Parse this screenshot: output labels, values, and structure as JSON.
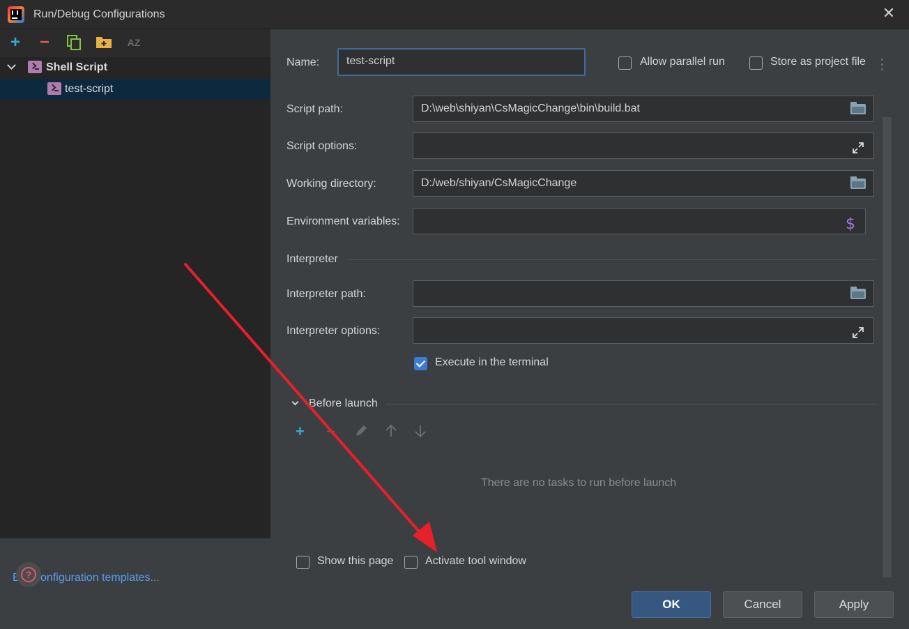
{
  "window": {
    "title": "Run/Debug Configurations"
  },
  "sidebar": {
    "toolbar": {
      "add": "+",
      "remove": "−",
      "copy": "copy-icon",
      "folder": "new-folder-icon",
      "sort": "AZ"
    },
    "tree": [
      {
        "label": "Shell Script",
        "expanded": true
      },
      {
        "label": "test-script",
        "selected": true
      }
    ],
    "edit_templates_link": "Edit configuration templates..."
  },
  "form": {
    "name_label": "Name:",
    "name_value": "test-script",
    "allow_parallel": {
      "label": "Allow parallel run",
      "checked": false
    },
    "store_project": {
      "label": "Store as project file",
      "checked": false
    },
    "script_path_label": "Script path:",
    "script_path_value": "D:\\web\\shiyan\\CsMagicChange\\bin\\build.bat",
    "script_options_label": "Script options:",
    "script_options_value": "",
    "working_dir_label": "Working directory:",
    "working_dir_value": "D:/web/shiyan/CsMagicChange",
    "env_vars_label": "Environment variables:",
    "env_vars_value": "",
    "interpreter_section": "Interpreter",
    "interpreter_path_label": "Interpreter path:",
    "interpreter_path_value": "",
    "interpreter_options_label": "Interpreter options:",
    "interpreter_options_value": "",
    "execute_terminal": {
      "label": "Execute in the terminal",
      "checked": true
    },
    "before_launch_section": "Before launch",
    "before_launch_empty": "There are no tasks to run before launch",
    "show_page": {
      "label": "Show this page",
      "checked": false
    },
    "activate_tool": {
      "label": "Activate tool window",
      "checked": false
    }
  },
  "buttons": {
    "ok": "OK",
    "cancel": "Cancel",
    "apply": "Apply"
  },
  "colors": {
    "accent": "#3d7bd4",
    "link": "#589df6",
    "annotation_arrow": "#e8202a",
    "add_icon": "#3aa5d8",
    "remove_icon": "#e05555"
  }
}
